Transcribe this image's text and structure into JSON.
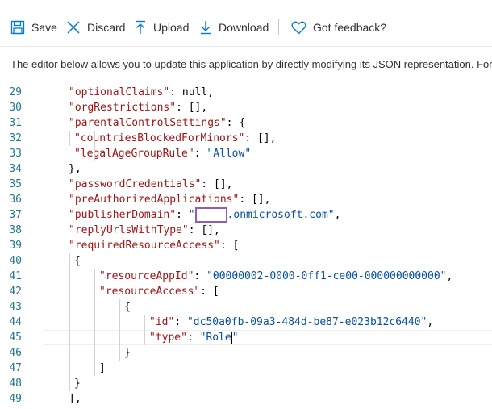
{
  "toolbar": {
    "save_label": "Save",
    "discard_label": "Discard",
    "upload_label": "Upload",
    "download_label": "Download",
    "feedback_label": "Got feedback?"
  },
  "description": "The editor below allows you to update this application by directly modifying its JSON representation. For",
  "editor": {
    "lines": [
      {
        "num": "29",
        "indent": 1,
        "key": "optionalClaims",
        "rest": ": null,"
      },
      {
        "num": "30",
        "indent": 1,
        "key": "orgRestrictions",
        "rest": ": [],"
      },
      {
        "num": "31",
        "indent": 1,
        "key": "parentalControlSettings",
        "rest": ": {"
      },
      {
        "num": "32",
        "indent": 2,
        "key": "countriesBlockedForMinors",
        "rest": ": [],"
      },
      {
        "num": "33",
        "indent": 2,
        "key": "legalAgeGroupRule",
        "rest": ": ",
        "val": "\"Allow\""
      },
      {
        "num": "34",
        "indent": 1,
        "plain": "},"
      },
      {
        "num": "35",
        "indent": 1,
        "key": "passwordCredentials",
        "rest": ": [],"
      },
      {
        "num": "36",
        "indent": 1,
        "key": "preAuthorizedApplications",
        "rest": ": [],"
      },
      {
        "num": "37",
        "indent": 1,
        "key": "publisherDomain",
        "rest": ": ",
        "val": "\"",
        "val2": ".onmicrosoft.com\"",
        "tail": ","
      },
      {
        "num": "38",
        "indent": 1,
        "key": "replyUrlsWithType",
        "rest": ": [],"
      },
      {
        "num": "39",
        "indent": 1,
        "key": "requiredResourceAccess",
        "rest": ": ["
      },
      {
        "num": "40",
        "indent": 2,
        "plain": "{"
      },
      {
        "num": "41",
        "indent": 3,
        "key": "resourceAppId",
        "rest": ": ",
        "val": "\"00000002-0000-0ff1-ce00-000000000000\"",
        "tail": ","
      },
      {
        "num": "42",
        "indent": 3,
        "key": "resourceAccess",
        "rest": ": ["
      },
      {
        "num": "43",
        "indent": 4,
        "plain": "{"
      },
      {
        "num": "44",
        "indent": 5,
        "key": "id",
        "rest": ": ",
        "val": "\"dc50a0fb-09a3-484d-be87-e023b12c6440\"",
        "tail": ","
      },
      {
        "num": "45",
        "indent": 5,
        "key": "type",
        "rest": ": ",
        "val": "\"Role\""
      },
      {
        "num": "46",
        "indent": 4,
        "plain": "}"
      },
      {
        "num": "47",
        "indent": 3,
        "plain": "]"
      },
      {
        "num": "48",
        "indent": 2,
        "plain": "}"
      },
      {
        "num": "49",
        "indent": 1,
        "plain": "],"
      }
    ]
  }
}
